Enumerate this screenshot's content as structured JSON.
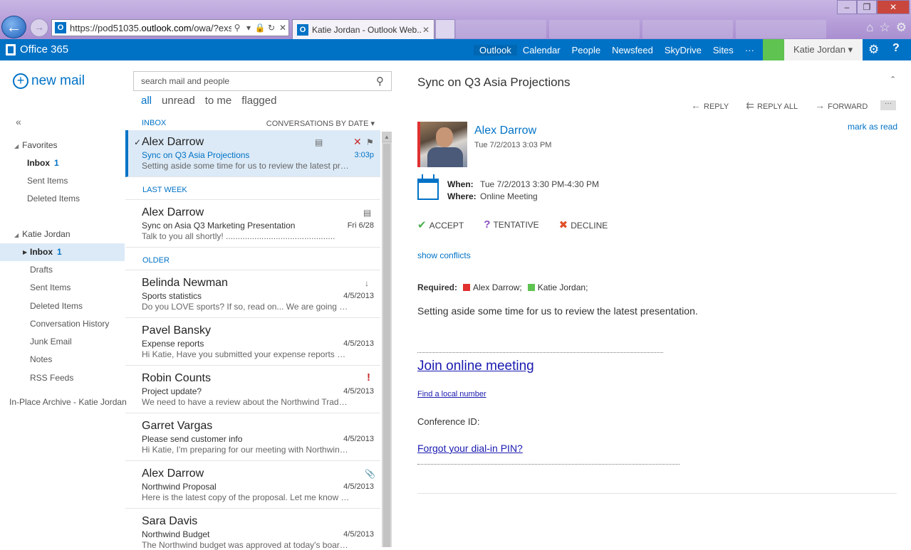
{
  "browser": {
    "url_prefix": "https://pod51035.",
    "url_domain": "outlook.com",
    "url_suffix": "/owa/?exsvu",
    "tab_title": "Katie Jordan - Outlook Web...",
    "favicon_letter": "O"
  },
  "suite": {
    "brand": "Office 365",
    "nav": [
      "Outlook",
      "Calendar",
      "People",
      "Newsfeed",
      "SkyDrive",
      "Sites",
      "···"
    ],
    "user": "Katie Jordan",
    "help": "?"
  },
  "leftnav": {
    "new_mail": "new mail",
    "collapse": "«",
    "favorites_label": "Favorites",
    "favorites": [
      {
        "label": "Inbox",
        "count": "1"
      },
      {
        "label": "Sent Items"
      },
      {
        "label": "Deleted Items"
      }
    ],
    "account_label": "Katie Jordan",
    "folders": [
      {
        "label": "Inbox",
        "count": "1"
      },
      {
        "label": "Drafts"
      },
      {
        "label": "Sent Items"
      },
      {
        "label": "Deleted Items"
      },
      {
        "label": "Conversation History"
      },
      {
        "label": "Junk Email"
      },
      {
        "label": "Notes"
      },
      {
        "label": "RSS Feeds"
      }
    ],
    "archive": "In-Place Archive - Katie Jordan"
  },
  "list": {
    "search_placeholder": "search mail and people",
    "filters": [
      "all",
      "unread",
      "to me",
      "flagged"
    ],
    "folder_label": "INBOX",
    "sort_label": "CONVERSATIONS BY DATE",
    "section_last_week": "LAST WEEK",
    "section_older": "OLDER",
    "messages": [
      {
        "from": "Alex Darrow",
        "subject": "Sync on Q3 Asia Projections",
        "preview": "Setting aside some time for us to review the latest presentation.",
        "date": "3:03p"
      },
      {
        "from": "Alex Darrow",
        "subject": "Sync on Asia Q3 Marketing Presentation",
        "preview": "Talk to you all shortly! ..............................................",
        "date": "Fri 6/28"
      },
      {
        "from": "Belinda Newman",
        "subject": "Sports statistics",
        "preview": "Do you LOVE sports? If so, read on... We are going to have a ...",
        "date": "4/5/2013"
      },
      {
        "from": "Pavel Bansky",
        "subject": "Expense reports",
        "preview": "Hi Katie, Have you submitted your expense reports yet?",
        "date": "4/5/2013"
      },
      {
        "from": "Robin Counts",
        "subject": "Project update?",
        "preview": "We need to have a review about the Northwind Traders project",
        "date": "4/5/2013"
      },
      {
        "from": "Garret Vargas",
        "subject": "Please send customer info",
        "preview": "Hi Katie, I'm preparing for our meeting with Northwind Traders",
        "date": "4/5/2013"
      },
      {
        "from": "Alex Darrow",
        "subject": "Northwind Proposal",
        "preview": "Here is the latest copy of the proposal. Let me know what you think",
        "date": "4/5/2013"
      },
      {
        "from": "Sara Davis",
        "subject": "Northwind Budget",
        "preview": "The Northwind budget was approved at today's board meeting",
        "date": "4/5/2013"
      }
    ]
  },
  "reading": {
    "title": "Sync on Q3 Asia Projections",
    "reply": "REPLY",
    "reply_all": "REPLY ALL",
    "forward": "FORWARD",
    "more": "···",
    "sender": "Alex Darrow",
    "sent": "Tue 7/2/2013 3:03 PM",
    "mark_as_read": "mark as read",
    "when_label": "When:",
    "when_value": "Tue 7/2/2013 3:30 PM-4:30 PM",
    "where_label": "Where:",
    "where_value": "Online Meeting",
    "accept": "ACCEPT",
    "tentative": "TENTATIVE",
    "decline": "DECLINE",
    "show_conflicts": "show conflicts",
    "required_label": "Required:",
    "attendees": [
      "Alex Darrow;",
      "Katie Jordan;"
    ],
    "attendee_colors": [
      "#e03030",
      "#5ec350"
    ],
    "body": "Setting aside some time for us to review the latest presentation.",
    "join": "Join online meeting",
    "local_number": "Find a local number",
    "conference_id": "Conference ID:",
    "forgot_pin": "Forgot your dial-in PIN?"
  },
  "colors": {
    "accent": "#0072c6",
    "suite_bar": "#0072c6",
    "selected_bg": "#dceaf7"
  }
}
